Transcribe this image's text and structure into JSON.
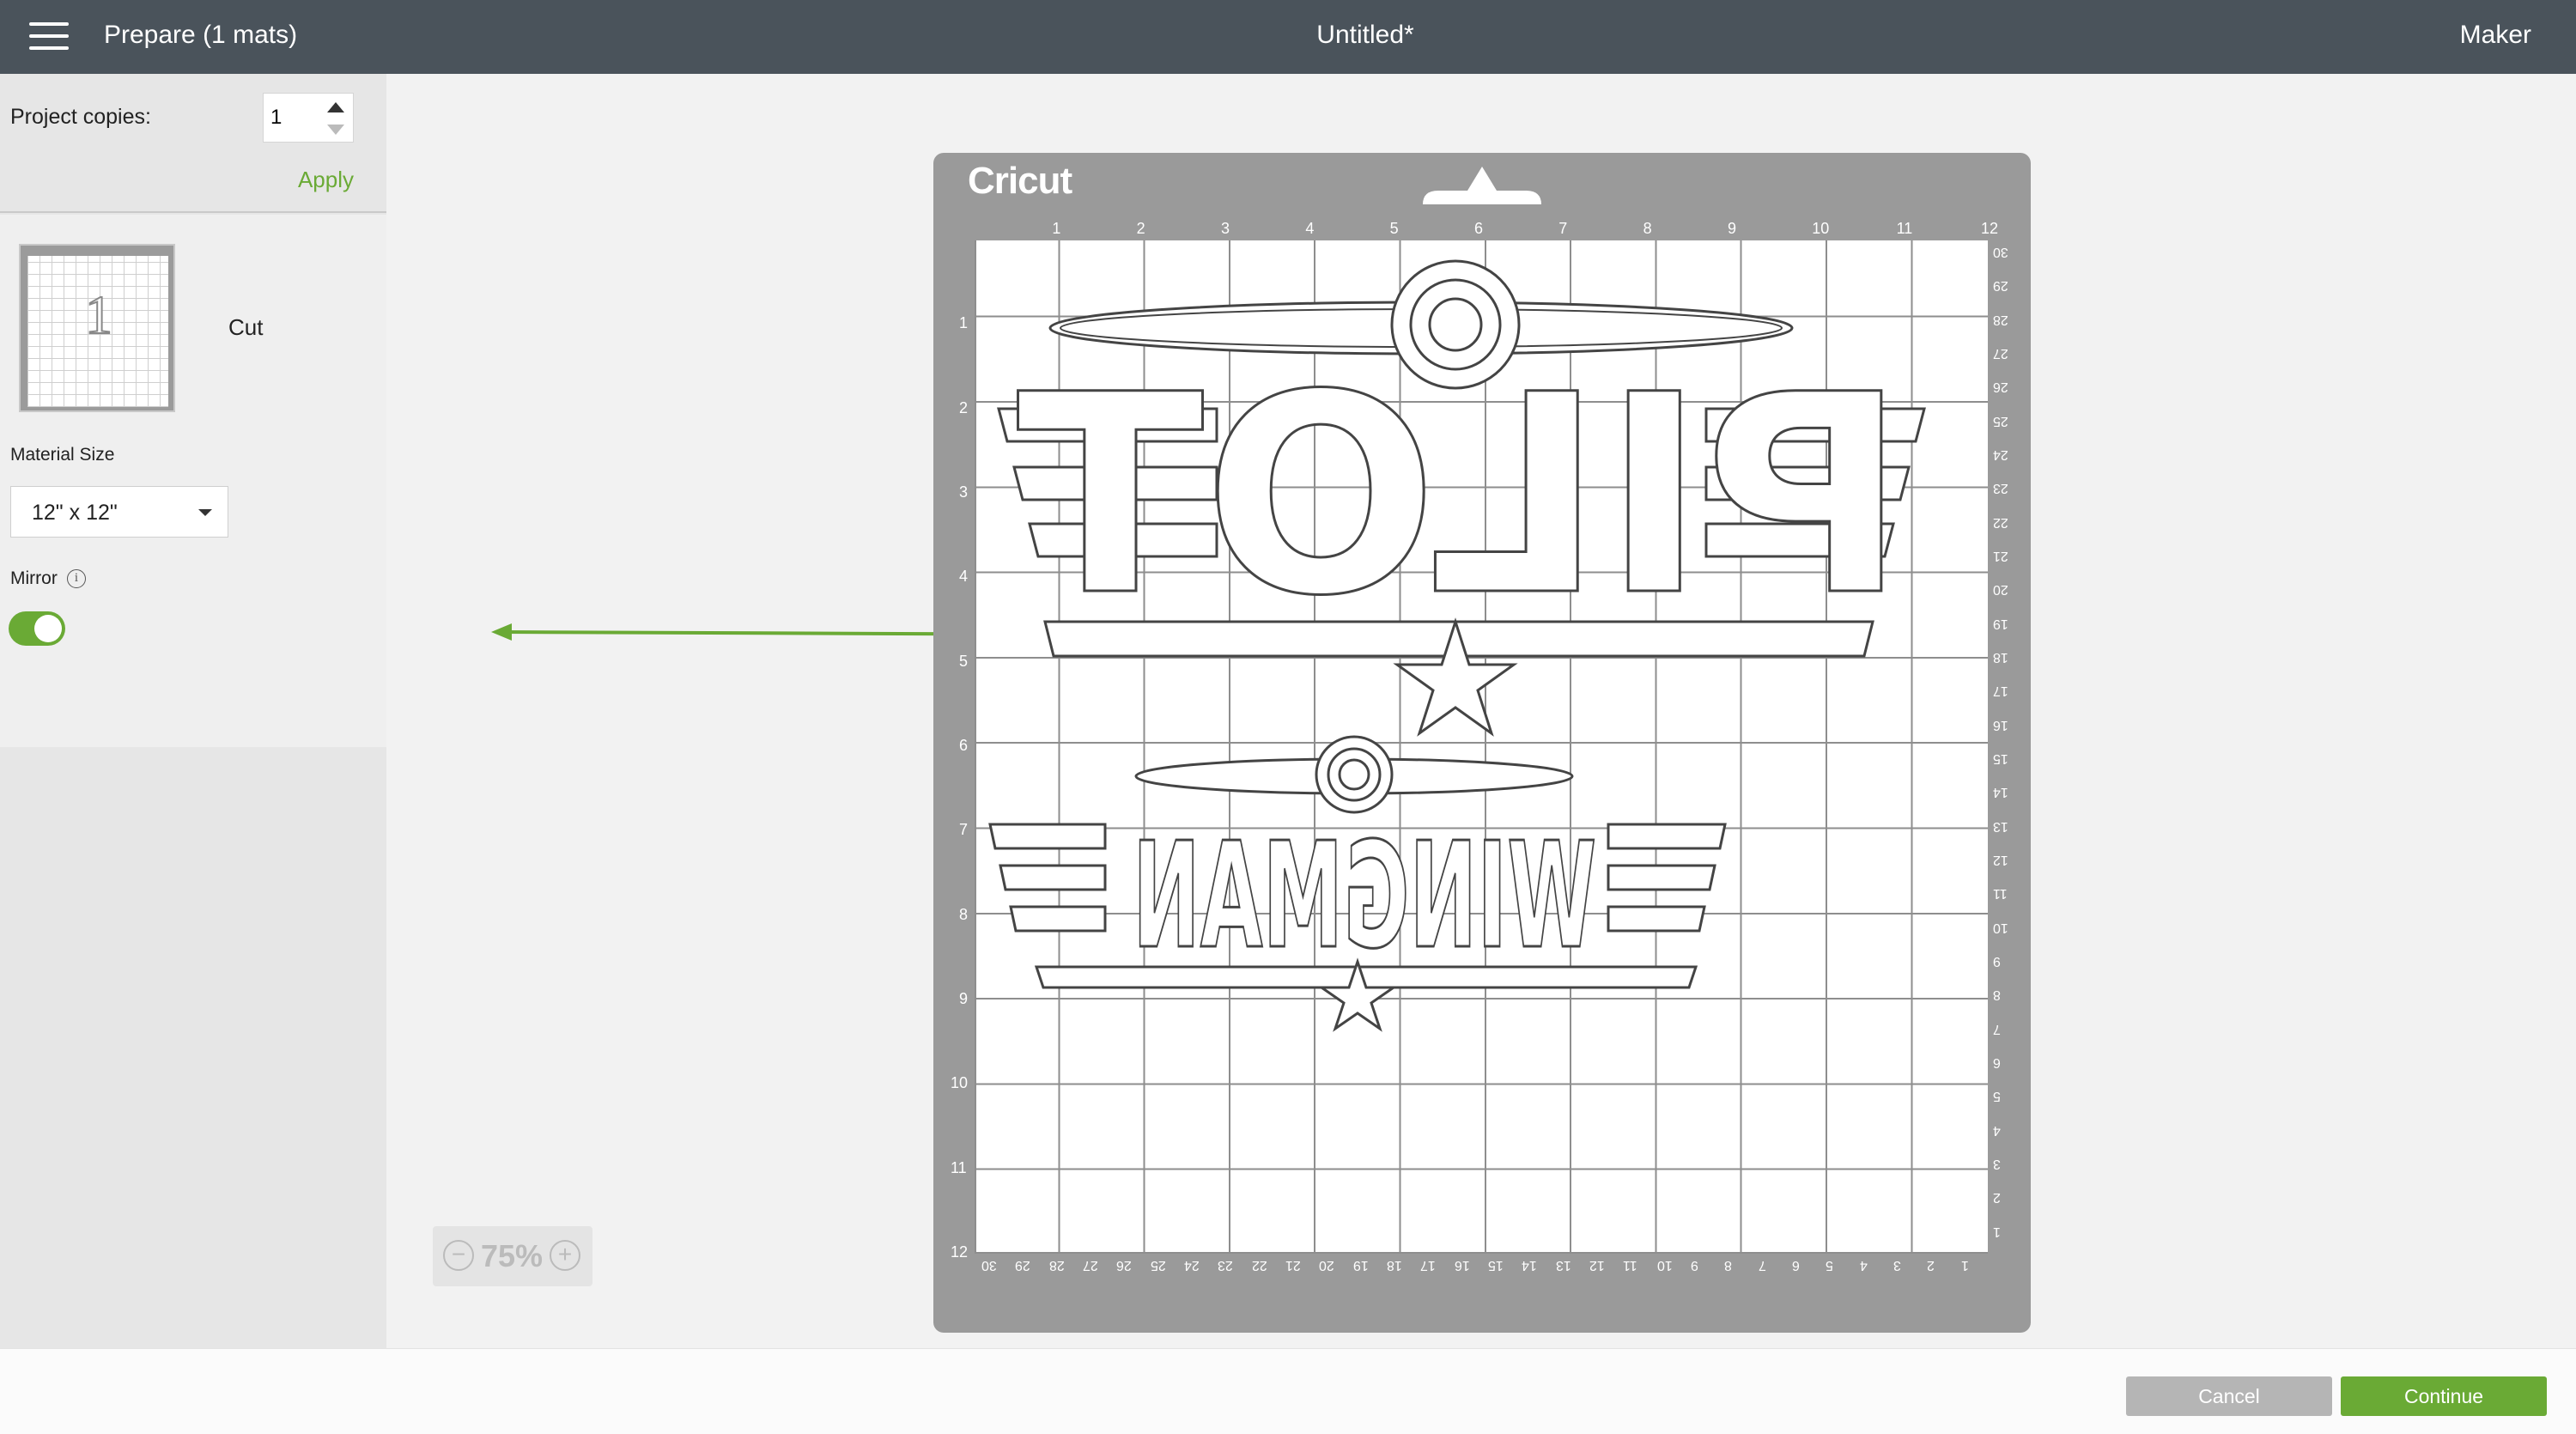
{
  "topbar": {
    "menu_icon": "hamburger-menu-icon",
    "app_title": "Prepare (1 mats)",
    "document_title": "Untitled*",
    "device": "Maker"
  },
  "left_panel": {
    "copies_label": "Project copies:",
    "copies_value": "1",
    "apply_label": "Apply",
    "mat": {
      "thumbnail_number": "1",
      "label": "Cut"
    },
    "material_size_label": "Material Size",
    "material_size_value": "12\" x 12\"",
    "mirror_label": "Mirror",
    "mirror_info_icon": "info-icon",
    "mirror_on": true
  },
  "mat": {
    "brand": "Cricut",
    "top_ruler": [
      "1",
      "2",
      "3",
      "4",
      "5",
      "6",
      "7",
      "8",
      "9",
      "10",
      "11",
      "12"
    ],
    "left_ruler": [
      "1",
      "2",
      "3",
      "4",
      "5",
      "6",
      "7",
      "8",
      "9",
      "10",
      "11",
      "12"
    ],
    "right_ruler": [
      "30",
      "29",
      "28",
      "27",
      "26",
      "25",
      "24",
      "23",
      "22",
      "21",
      "20",
      "19",
      "18",
      "17",
      "16",
      "15",
      "14",
      "13",
      "12",
      "11",
      "10",
      "9",
      "8",
      "7",
      "6",
      "5",
      "4",
      "3",
      "2",
      "1"
    ],
    "bottom_ruler": [
      "30",
      "29",
      "28",
      "27",
      "26",
      "25",
      "24",
      "23",
      "22",
      "21",
      "20",
      "19",
      "18",
      "17",
      "16",
      "15",
      "14",
      "13",
      "12",
      "11",
      "10",
      "9",
      "8",
      "7",
      "6",
      "5",
      "4",
      "3",
      "2",
      "1"
    ],
    "design_words": [
      "PILOT",
      "WINGMAN"
    ]
  },
  "zoom": {
    "level": "75%",
    "minus": "−",
    "plus": "+"
  },
  "bottom_bar": {
    "cancel_label": "Cancel",
    "continue_label": "Continue"
  },
  "colors": {
    "topbar": "#4a535b",
    "accent_green": "#6aaa35",
    "mat_gray": "#9a9a9a"
  }
}
